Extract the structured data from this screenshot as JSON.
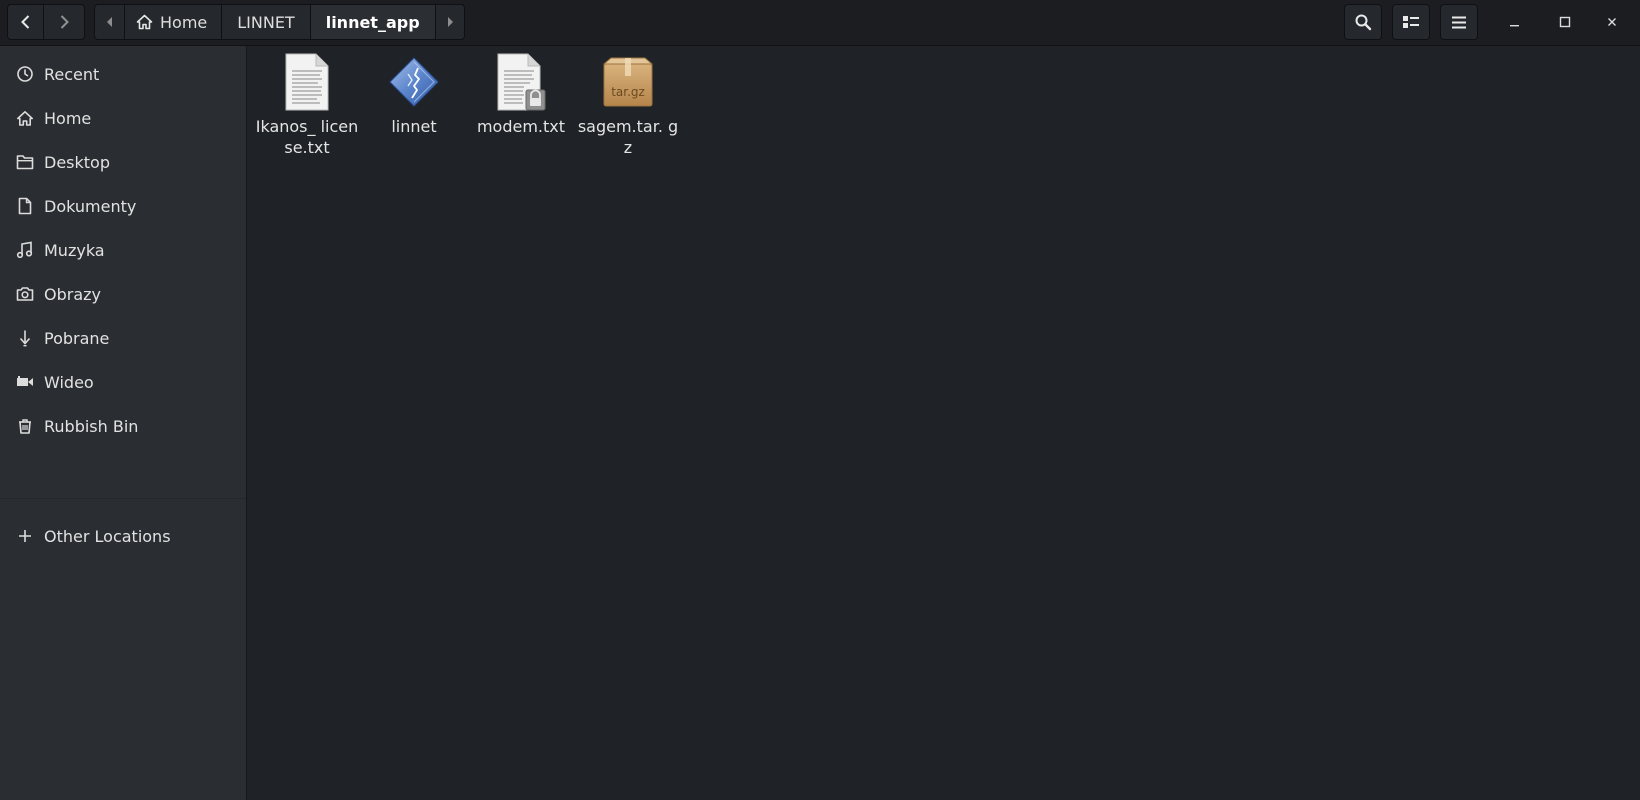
{
  "breadcrumb": {
    "items": [
      "Home",
      "LINNET",
      "linnet_app"
    ]
  },
  "sidebar": {
    "items": [
      {
        "label": "Recent",
        "icon": "clock-icon"
      },
      {
        "label": "Home",
        "icon": "home-icon"
      },
      {
        "label": "Desktop",
        "icon": "folder-icon"
      },
      {
        "label": "Dokumenty",
        "icon": "document-icon"
      },
      {
        "label": "Muzyka",
        "icon": "music-icon"
      },
      {
        "label": "Obrazy",
        "icon": "camera-icon"
      },
      {
        "label": "Pobrane",
        "icon": "download-icon"
      },
      {
        "label": "Wideo",
        "icon": "video-icon"
      },
      {
        "label": "Rubbish Bin",
        "icon": "trash-icon"
      }
    ],
    "other_locations": "Other Locations"
  },
  "files": [
    {
      "name": "Ikanos_ license.txt",
      "icon": "text-file-icon"
    },
    {
      "name": "linnet",
      "icon": "executable-icon"
    },
    {
      "name": "modem.txt",
      "icon": "locked-text-file-icon"
    },
    {
      "name": "sagem.tar. gz",
      "icon": "archive-icon",
      "badge": "tar.gz"
    }
  ]
}
